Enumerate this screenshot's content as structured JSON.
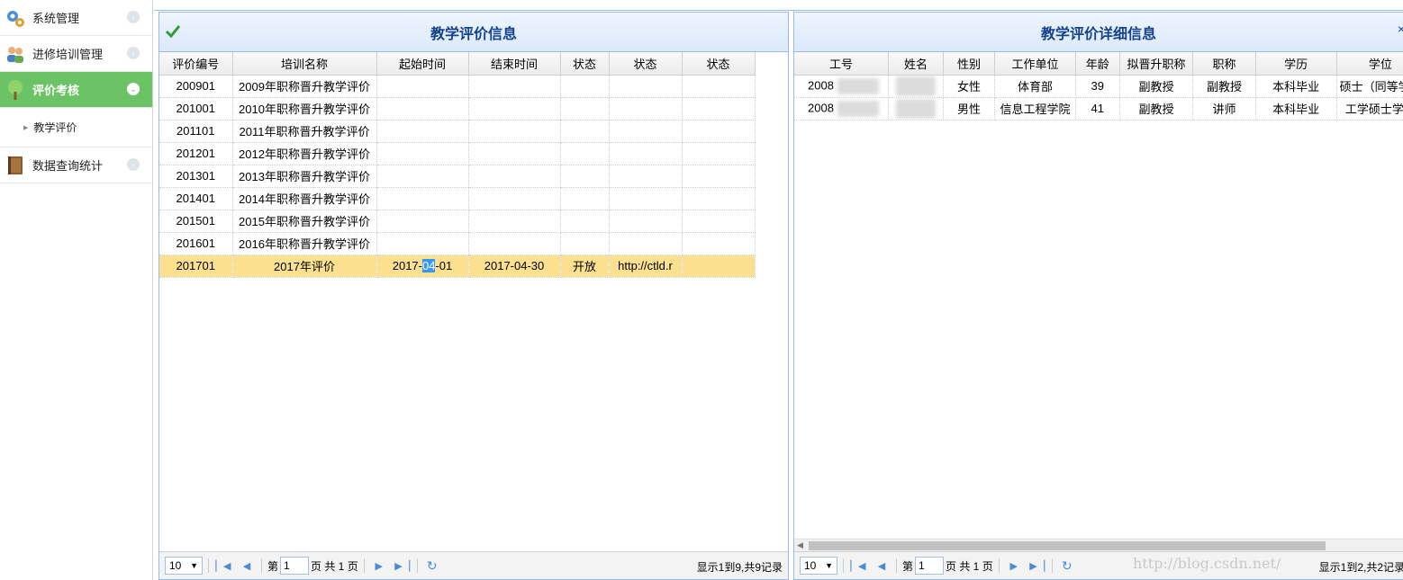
{
  "sidebar": {
    "items": [
      {
        "label": "系统管理",
        "icon": "gears-icon"
      },
      {
        "label": "进修培训管理",
        "icon": "users-icon"
      },
      {
        "label": "评价考核",
        "icon": "tree-icon"
      },
      {
        "label": "数据查询统计",
        "icon": "book-icon"
      }
    ],
    "submenu": {
      "label": "教学评价"
    }
  },
  "left_panel": {
    "title": "教学评价信息",
    "columns": [
      "评价编号",
      "培训名称",
      "起始时间",
      "结束时间",
      "状态",
      "状态",
      "状态"
    ],
    "rows": [
      [
        "200901",
        "2009年职称晋升教学评价",
        "",
        "",
        "",
        "",
        ""
      ],
      [
        "201001",
        "2010年职称晋升教学评价",
        "",
        "",
        "",
        "",
        ""
      ],
      [
        "201101",
        "2011年职称晋升教学评价",
        "",
        "",
        "",
        "",
        ""
      ],
      [
        "201201",
        "2012年职称晋升教学评价",
        "",
        "",
        "",
        "",
        ""
      ],
      [
        "201301",
        "2013年职称晋升教学评价",
        "",
        "",
        "",
        "",
        ""
      ],
      [
        "201401",
        "2014年职称晋升教学评价",
        "",
        "",
        "",
        "",
        ""
      ],
      [
        "201501",
        "2015年职称晋升教学评价",
        "",
        "",
        "",
        "",
        ""
      ],
      [
        "201601",
        "2016年职称晋升教学评价",
        "",
        "",
        "",
        "",
        ""
      ]
    ],
    "selected_row": {
      "id": "201701",
      "name": "2017年评价",
      "start_pre": "2017-",
      "start_sel": "04",
      "start_post": "-01",
      "end": "2017-04-30",
      "status": "开放",
      "link": "http://ctld.r",
      "extra": ""
    },
    "pager": {
      "page_size": "10",
      "page_prefix": "第",
      "page": "1",
      "page_suffix": "页 共 1 页",
      "info": "显示1到9,共9记录"
    }
  },
  "right_panel": {
    "title": "教学评价详细信息",
    "close_glyph": "×",
    "columns": [
      "工号",
      "姓名",
      "性别",
      "工作单位",
      "年龄",
      "拟晋升职称",
      "职称",
      "学历",
      "学位"
    ],
    "rows": [
      [
        "2008",
        "",
        "女性",
        "体育部",
        "39",
        "副教授",
        "副教授",
        "本科毕业",
        "硕士（同等学力"
      ],
      [
        "2008",
        "",
        "男性",
        "信息工程学院",
        "41",
        "副教授",
        "讲师",
        "本科毕业",
        "工学硕士学位"
      ]
    ],
    "pager": {
      "page_size": "10",
      "page_prefix": "第",
      "page": "1",
      "page_suffix": "页 共 1 页",
      "info": "显示1到2,共2记录"
    }
  },
  "watermark": "http://blog.csdn.net/"
}
